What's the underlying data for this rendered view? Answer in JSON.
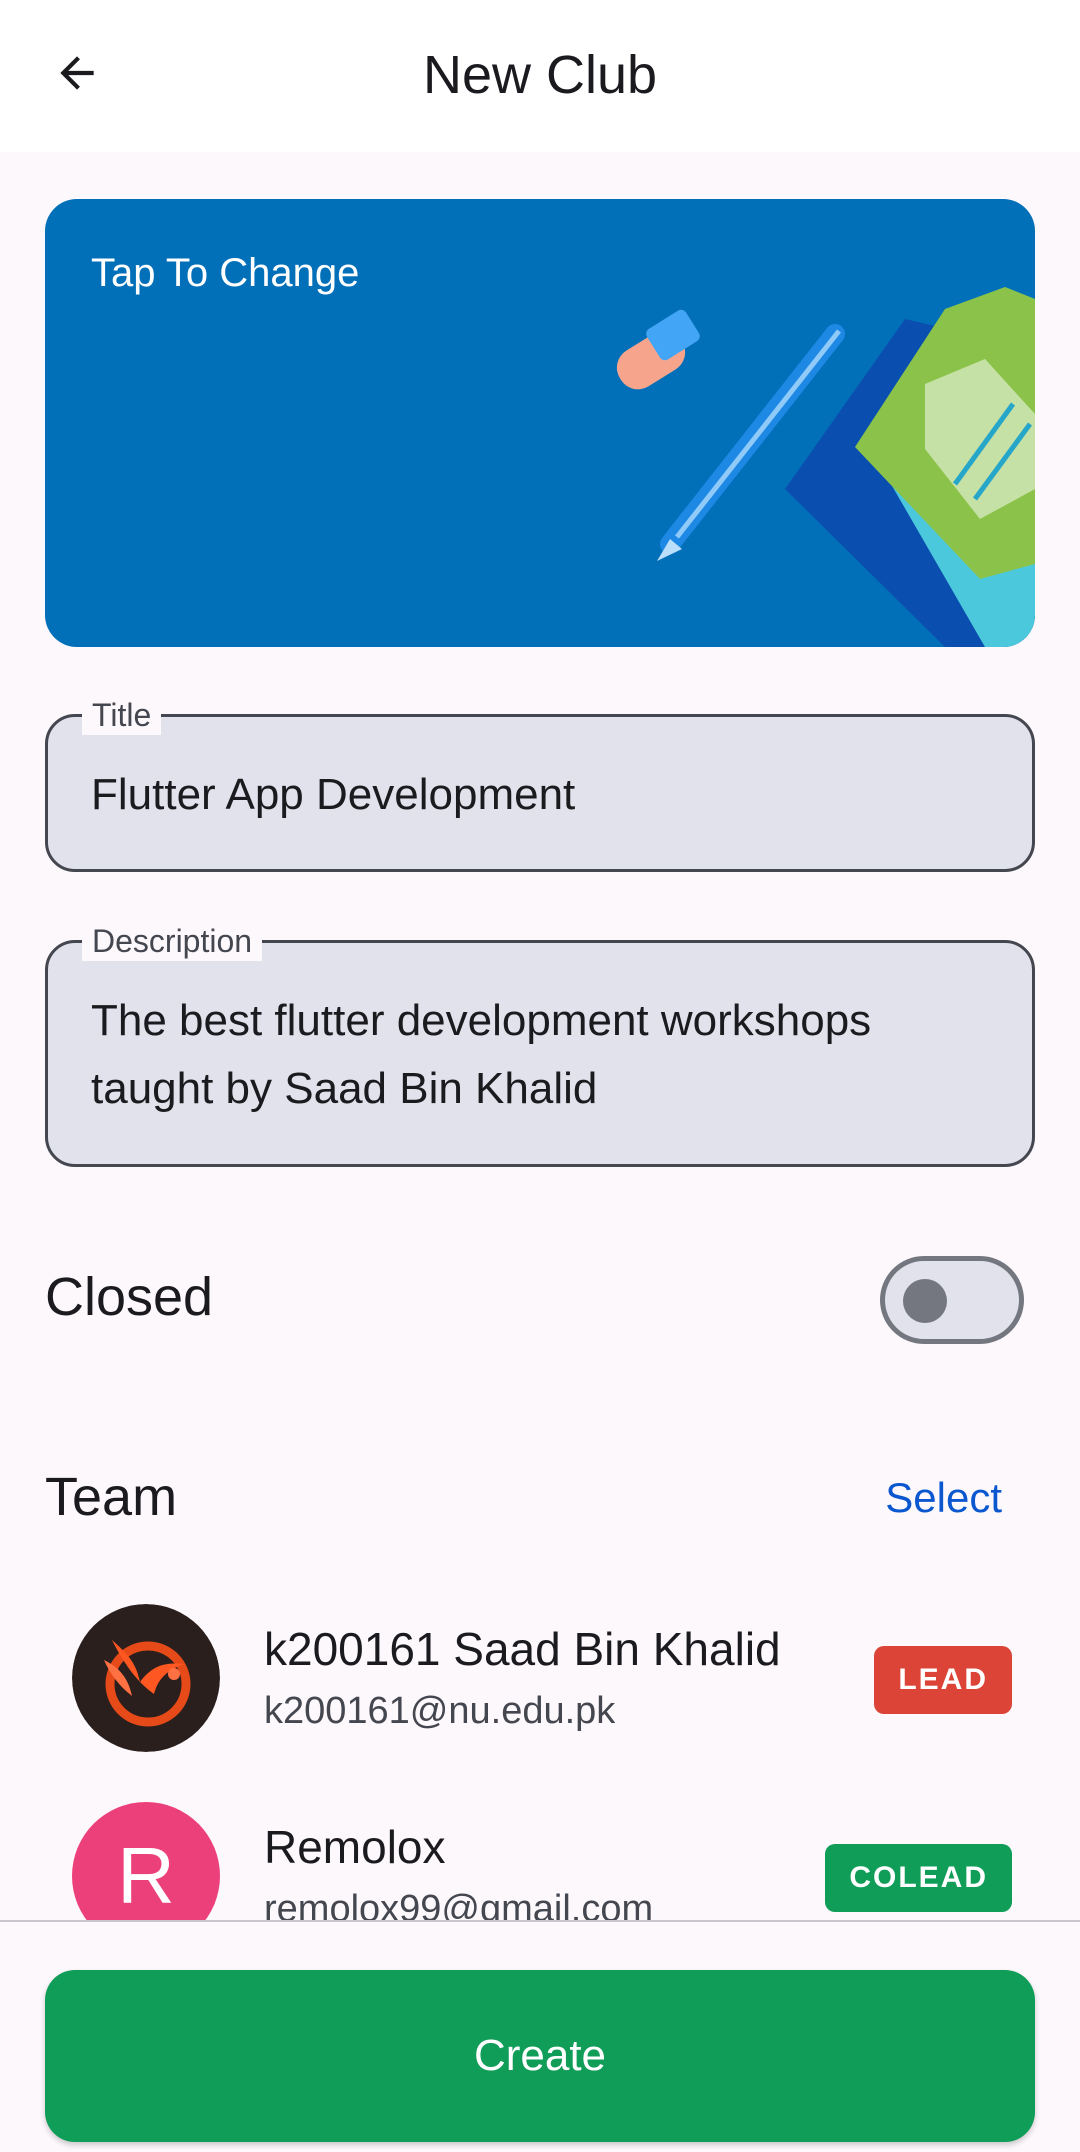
{
  "header": {
    "title": "New Club",
    "back_icon": "arrow-back-icon"
  },
  "banner": {
    "label": "Tap To Change",
    "background_color": "#0270b9"
  },
  "form": {
    "title_label": "Title",
    "title_value": "Flutter App Development",
    "description_label": "Description",
    "description_value": "The best flutter development workshops taught by Saad Bin Khalid"
  },
  "closed": {
    "label": "Closed",
    "enabled": false
  },
  "team": {
    "label": "Team",
    "select_label": "Select",
    "members": [
      {
        "name": "k200161 Saad Bin Khalid",
        "email": "k200161@nu.edu.pk",
        "role": "LEAD",
        "role_color": "#db4437",
        "avatar": "phoenix-logo"
      },
      {
        "name": "Remolox",
        "email": "remolox99@gmail.com",
        "role": "COLEAD",
        "role_color": "#0f9d58",
        "avatar_letter": "R",
        "avatar_color": "#ec407a"
      }
    ]
  },
  "actions": {
    "create_label": "Create",
    "create_color": "#0f9d58"
  }
}
